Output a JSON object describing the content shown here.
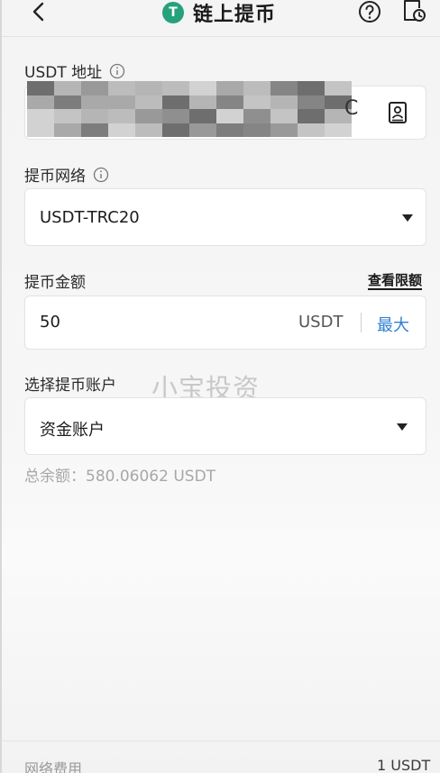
{
  "header": {
    "title": "链上提币",
    "coin_symbol": "T",
    "icons": [
      "back-arrow-icon",
      "tether-coin-icon",
      "help-icon",
      "history-icon"
    ]
  },
  "address": {
    "label": "USDT 地址",
    "visible_tail": "C",
    "icon": "contact-book-icon"
  },
  "network": {
    "label": "提币网络",
    "selected": "USDT-TRC20"
  },
  "amount": {
    "label": "提币金额",
    "limit_link": "查看限额",
    "value": "50",
    "unit": "USDT",
    "max_label": "最大"
  },
  "account": {
    "label": "选择提币账户",
    "selected": "资金账户"
  },
  "watermark": "小宝投资",
  "balance_text": "总余额：580.06062 USDT",
  "fee": {
    "label": "网络费用",
    "value": "1 USDT"
  },
  "colors": {
    "accent_blue": "#2f7fd1",
    "tether_green": "#26a17b"
  }
}
